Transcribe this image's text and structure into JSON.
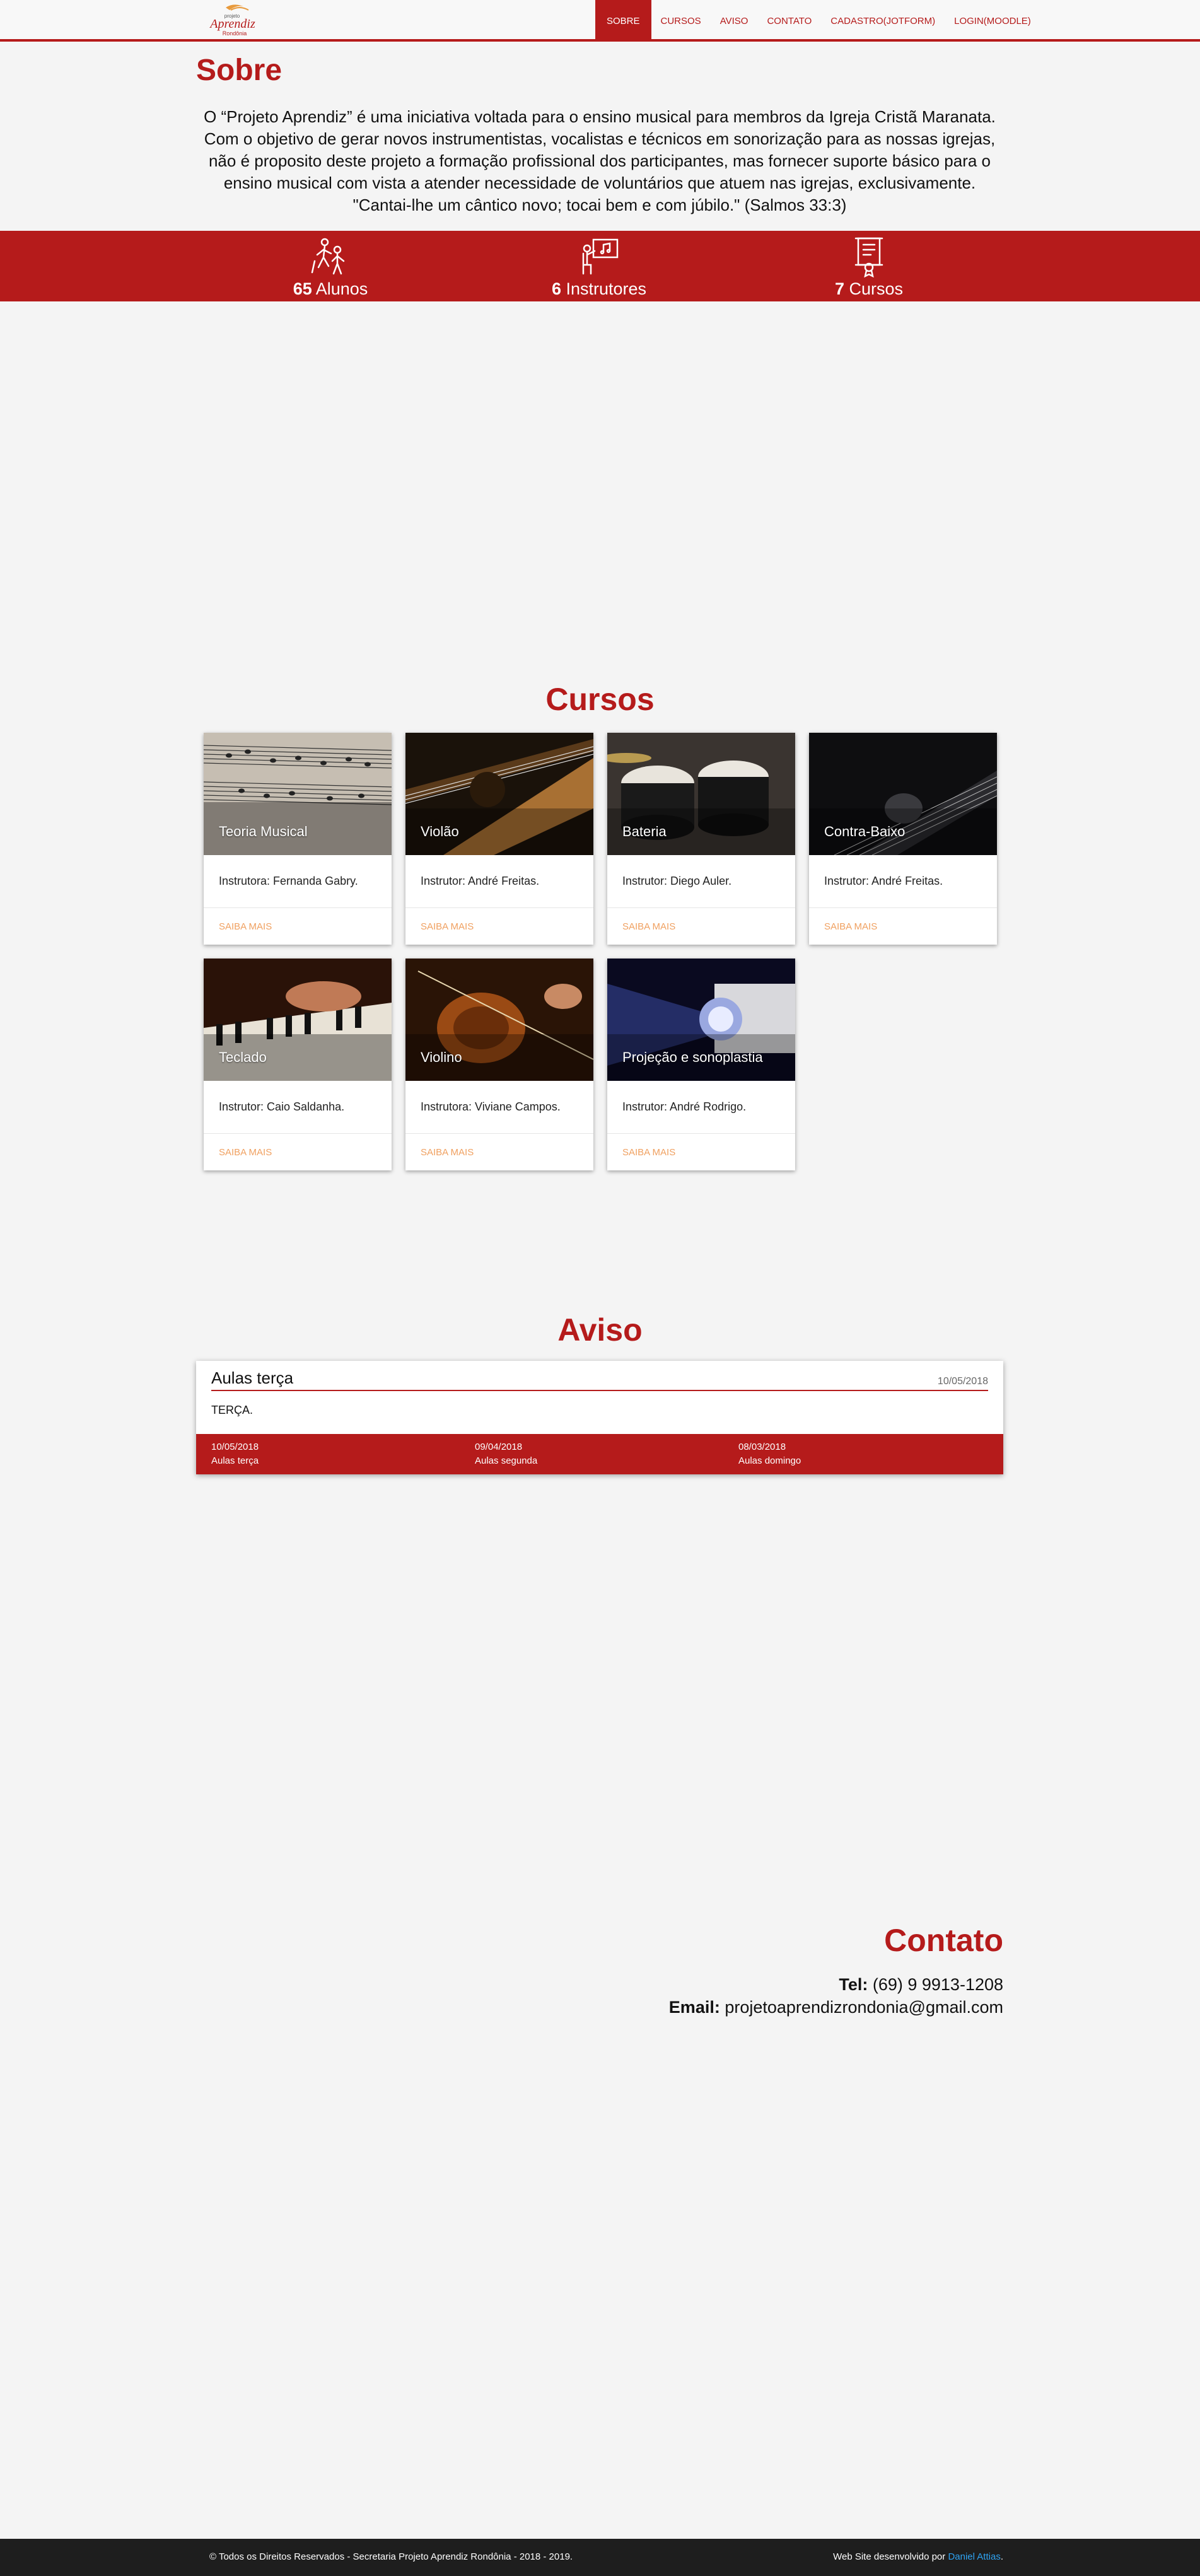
{
  "nav": {
    "logo_alt": "Projeto Aprendiz Rondônia",
    "logo_small": "projeto",
    "logo_main": "Aprendiz",
    "logo_sub": "Rondônia",
    "items": [
      {
        "label": "SOBRE",
        "active": true
      },
      {
        "label": "CURSOS",
        "active": false
      },
      {
        "label": "AVISO",
        "active": false
      },
      {
        "label": "CONTATO",
        "active": false
      },
      {
        "label": "CADASTRO(JOTFORM)",
        "active": false
      },
      {
        "label": "LOGIN(MOODLE)",
        "active": false
      }
    ]
  },
  "sobre": {
    "title": "Sobre",
    "text": "O “Projeto Aprendiz” é uma iniciativa voltada para o ensino musical para membros da Igreja Cristã Maranata. Com o objetivo de gerar novos instrumentistas, vocalistas e técnicos em sonorização para as nossas igrejas, não é proposito deste projeto a formação profissional dos participantes, mas fornecer suporte básico para o ensino musical com vista a atender necessidade de voluntários que atuem nas igrejas, exclusivamente. \"Cantai-lhe um cântico novo; tocai bem e com júbilo.\" (Salmos 33:3)"
  },
  "stats": [
    {
      "value": "65",
      "label": "Alunos",
      "icon": "students-icon"
    },
    {
      "value": "6",
      "label": "Instrutores",
      "icon": "teacher-icon"
    },
    {
      "value": "7",
      "label": "Cursos",
      "icon": "certificate-icon"
    }
  ],
  "cursos": {
    "title": "Cursos",
    "action_label": "SAIBA MAIS",
    "items": [
      {
        "title": "Teoria Musical",
        "instructor": "Instrutora: Fernanda Gabry."
      },
      {
        "title": "Violão",
        "instructor": "Instrutor: André Freitas."
      },
      {
        "title": "Bateria",
        "instructor": "Instrutor: Diego Auler."
      },
      {
        "title": "Contra-Baixo",
        "instructor": "Instrutor: André Freitas."
      },
      {
        "title": "Teclado",
        "instructor": "Instrutor: Caio Saldanha."
      },
      {
        "title": "Violino",
        "instructor": "Instrutora: Viviane Campos."
      },
      {
        "title": "Projeção e sonoplastia",
        "instructor": "Instrutor: André Rodrigo."
      }
    ]
  },
  "aviso": {
    "title": "Aviso",
    "current": {
      "title": "Aulas terça",
      "date": "10/05/2018",
      "content": "TERÇA."
    },
    "list": [
      {
        "date": "10/05/2018",
        "title": "Aulas terça"
      },
      {
        "date": "09/04/2018",
        "title": "Aulas segunda"
      },
      {
        "date": "08/03/2018",
        "title": "Aulas domingo"
      }
    ]
  },
  "contato": {
    "title": "Contato",
    "tel_label": "Tel:",
    "tel": "(69) 9 9913-1208",
    "email_label": "Email:",
    "email": "projetoaprendizrondonia@gmail.com"
  },
  "footer": {
    "copyright": "© Todos os Direitos Reservados - Secretaria Projeto Aprendiz Rondônia - 2018 - 2019.",
    "credit_prefix": "Web Site desenvolvido por",
    "credit_name": "Daniel Attias",
    "credit_suffix": "."
  },
  "colors": {
    "brand": "#b51b1b",
    "footer": "#1e1e1e",
    "background": "#f4f4f4",
    "link": "#2ea3f2",
    "action": "#f0a060"
  }
}
